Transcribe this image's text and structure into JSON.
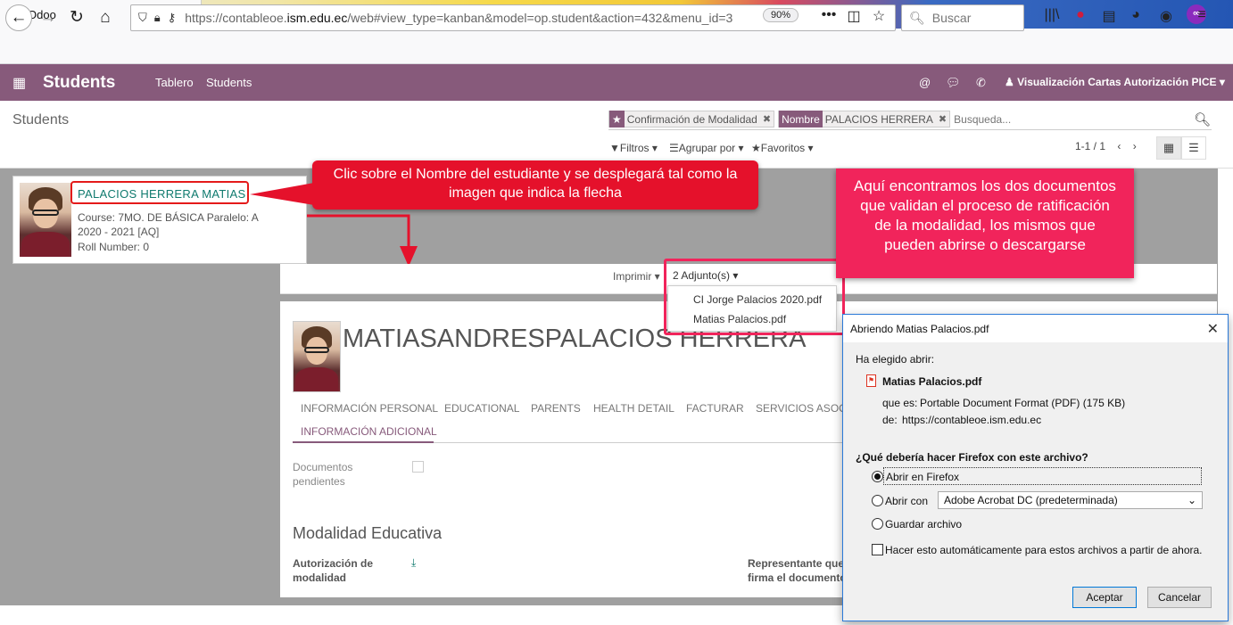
{
  "browser": {
    "tab_title": "Odoo",
    "tab_close": "✕",
    "new_tab": "+",
    "url_prefix": "https://contableoe.",
    "url_domain": "ism.edu.ec",
    "url_rest": "/web#view_type=kanban&model=op.student&action=432&menu_id=3",
    "zoom": "90%",
    "search_placeholder": "Buscar",
    "icons": [
      "back-icon",
      "forward-icon",
      "reload-icon",
      "home-icon",
      "shield-icon",
      "lock-icon",
      "key-icon",
      "more-icon",
      "pocket-icon",
      "star-icon",
      "library-icon",
      "extension-icon",
      "reader-icon",
      "extension2-icon",
      "account-icon",
      "menu-icon",
      "private-mask-icon"
    ]
  },
  "odoo": {
    "app_title": "Students",
    "menu": [
      "Tablero",
      "Students"
    ],
    "user": "Visualización Cartas Autorización PICE",
    "breadcrumb": "Students",
    "facets": [
      {
        "label": "★",
        "value": "Confirmación de Modalidad"
      },
      {
        "label": "Nombre",
        "value": "PALACIOS HERRERA"
      }
    ],
    "search_placeholder": "Busqueda...",
    "filters": "Filtros",
    "group_by": "Agrupar por",
    "favorites": "Favoritos",
    "pager": "1-1 / 1"
  },
  "card": {
    "name": "PALACIOS HERRERA MATIAS",
    "course": "Course: 7MO. DE BÁSICA Paralelo: A",
    "year": "2020 - 2021 [AQ]",
    "roll": "Roll Number: 0"
  },
  "callouts": {
    "first": "Clic sobre el Nombre del estudiante y se desplegará tal como la imagen que indica la flecha",
    "second": "Aquí encontramos los dos documentos que validan el proceso de ratificación de la modalidad, los mismos que pueden abrirse o descargarse"
  },
  "form": {
    "print": "Imprimir",
    "attachments": "2 Adjunto(s)",
    "attachment_items": [
      "CI Jorge Palacios 2020.pdf",
      "Matias Palacios.pdf"
    ],
    "title": "MATIASANDRESPALACIOS HERRERA",
    "tabs": [
      "INFORMACIÓN PERSONAL",
      "EDUCATIONAL",
      "PARENTS",
      "HEALTH DETAIL",
      "FACTURAR",
      "SERVICIOS ASOCI"
    ],
    "active_tab": "INFORMACIÓN ADICIONAL",
    "docs_label_1": "Documentos",
    "docs_label_2": "pendientes",
    "section": "Modalidad Educativa",
    "auth_1": "Autorización de",
    "auth_2": "modalidad",
    "rep_1": "Representante que",
    "rep_2": "firma el documento"
  },
  "dialog": {
    "title": "Abriendo Matias Palacios.pdf",
    "chosen": "Ha elegido abrir:",
    "file": "Matias Palacios.pdf",
    "type_label": "que es:",
    "type_value": "Portable Document Format (PDF) (175 KB)",
    "from_label": "de:",
    "from_value": "https://contableoe.ism.edu.ec",
    "question": "¿Qué debería hacer Firefox con este archivo?",
    "opt_open": "Abrir en Firefox",
    "opt_with": "Abrir con",
    "app": "Adobe Acrobat DC (predeterminada)",
    "opt_save": "Guardar archivo",
    "auto": "Hacer esto automáticamente para estos archivos a partir de ahora.",
    "ok": "Aceptar",
    "cancel": "Cancelar"
  }
}
